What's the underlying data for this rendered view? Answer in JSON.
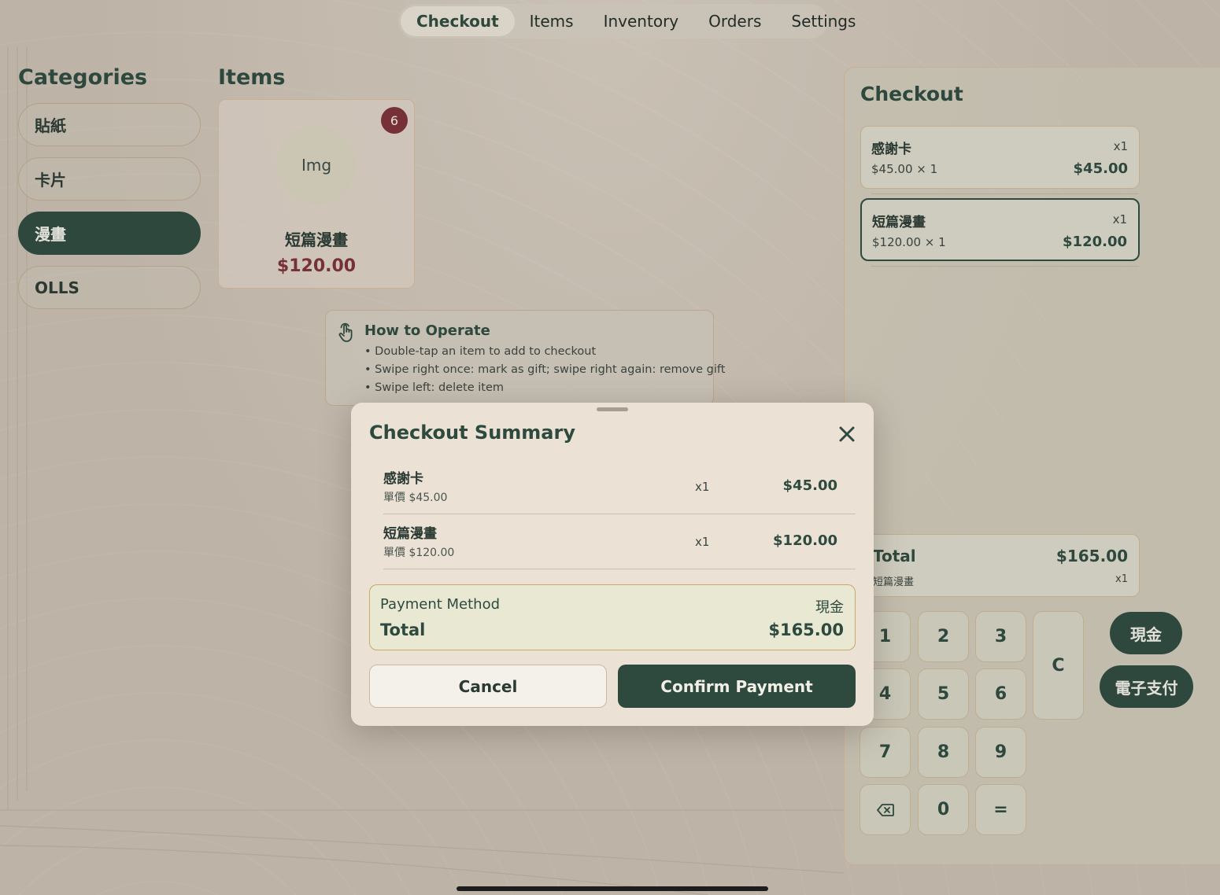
{
  "nav": {
    "tabs": [
      {
        "label": "Checkout",
        "active": true
      },
      {
        "label": "Items",
        "active": false
      },
      {
        "label": "Inventory",
        "active": false
      },
      {
        "label": "Orders",
        "active": false
      },
      {
        "label": "Settings",
        "active": false
      }
    ]
  },
  "categories": {
    "title": "Categories",
    "items": [
      {
        "label": "貼紙",
        "active": false
      },
      {
        "label": "卡片",
        "active": false
      },
      {
        "label": "漫畫",
        "active": true
      },
      {
        "label": "OLLS",
        "active": false
      }
    ]
  },
  "items": {
    "title": "Items",
    "cards": [
      {
        "image_placeholder": "Img",
        "badge": "6",
        "name": "短篇漫畫",
        "price": "$120.00"
      }
    ]
  },
  "howto": {
    "icon": "hand-tap-icon",
    "title": "How to Operate",
    "tips": [
      "• Double-tap an item to add to checkout",
      "• Swipe right once: mark as gift; swipe right again: remove gift",
      "• Swipe left: delete item"
    ]
  },
  "checkout": {
    "title": "Checkout",
    "lines": [
      {
        "name": "感謝卡",
        "qty": "x1",
        "unit": "$45.00 × 1",
        "total": "$45.00",
        "selected": false
      },
      {
        "name": "短篇漫畫",
        "qty": "x1",
        "unit": "$120.00 × 1",
        "total": "$120.00",
        "selected": true
      }
    ],
    "total": {
      "label": "Total",
      "value": "$165.00",
      "subtitle": "短篇漫畫",
      "subqty": "x1"
    },
    "keypad": [
      "1",
      "2",
      "3",
      "C",
      "4",
      "5",
      "6",
      "7",
      "8",
      "9",
      "backspace-icon",
      "0",
      "="
    ],
    "payment_buttons": [
      "現金",
      "電子支付"
    ]
  },
  "modal": {
    "title": "Checkout Summary",
    "rows": [
      {
        "name": "感謝卡",
        "unit": "單價 $45.00",
        "qty": "x1",
        "total": "$45.00"
      },
      {
        "name": "短篇漫畫",
        "unit": "單價 $120.00",
        "qty": "x1",
        "total": "$120.00"
      }
    ],
    "payment_method_label": "Payment Method",
    "payment_method_value": "現金",
    "total_label": "Total",
    "total_value": "$165.00",
    "cancel_label": "Cancel",
    "confirm_label": "Confirm Payment"
  },
  "colors": {
    "accent": "#2e4a3f",
    "price": "#7a3138",
    "background": "#c5bcaf",
    "sheet": "#ebe2d5"
  }
}
